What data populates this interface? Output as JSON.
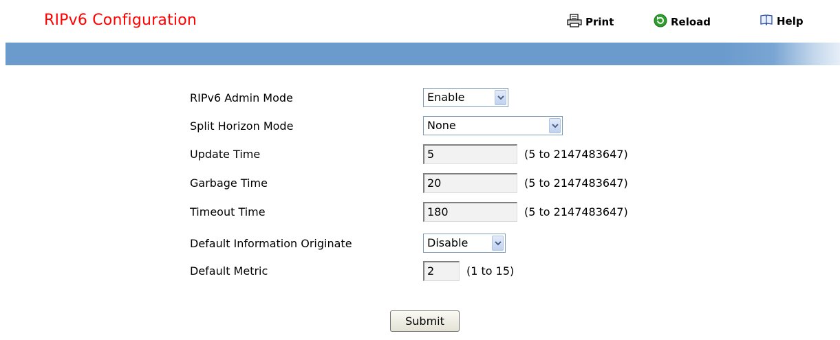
{
  "page": {
    "title": "RIPv6 Configuration"
  },
  "header_buttons": {
    "print": "Print",
    "reload": "Reload",
    "help": "Help"
  },
  "form": {
    "admin_mode": {
      "label": "RIPv6 Admin Mode",
      "value": "Enable"
    },
    "split_horizon": {
      "label": "Split Horizon Mode",
      "value": "None"
    },
    "update_time": {
      "label": "Update Time",
      "value": "5",
      "range": "(5 to 2147483647)"
    },
    "garbage_time": {
      "label": "Garbage Time",
      "value": "20",
      "range": "(5 to 2147483647)"
    },
    "timeout_time": {
      "label": "Timeout Time",
      "value": "180",
      "range": "(5 to 2147483647)"
    },
    "default_info_originate": {
      "label": "Default Information Originate",
      "value": "Disable"
    },
    "default_metric": {
      "label": "Default Metric",
      "value": "2",
      "range": "(1 to 15)"
    }
  },
  "actions": {
    "submit": "Submit"
  },
  "colors": {
    "title": "#ff0000",
    "band": "#6b9bcd",
    "reload_icon": "#2e9e2e"
  },
  "icons": {
    "print": "printer-icon",
    "reload": "reload-icon",
    "help": "book-icon",
    "dropdown": "chevron-down-icon"
  }
}
